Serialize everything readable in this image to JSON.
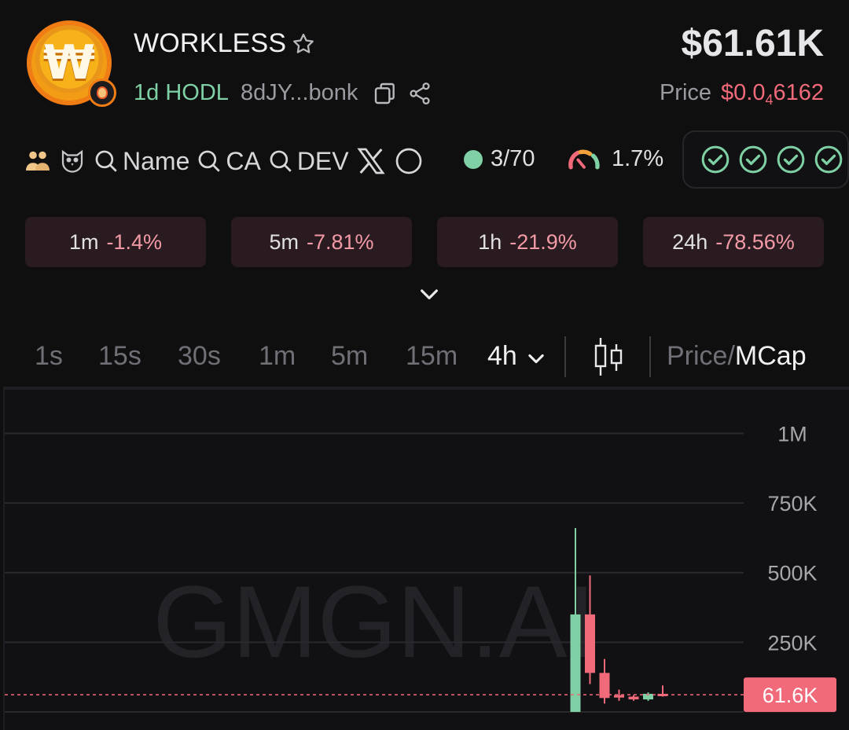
{
  "token": {
    "name": "WORKLESS",
    "logo_glyph": "₩",
    "age": "1d",
    "tag": "HODL",
    "contract_short": "8dJY...bonk",
    "market_cap": "$61.61K",
    "price_label": "Price",
    "price_prefix": "$0.0",
    "price_zeros": "4",
    "price_digits": "6162"
  },
  "toolbar": {
    "search_chips": [
      "Name",
      "CA",
      "DEV"
    ],
    "holders": "3/70",
    "top10_percent": "1.7%",
    "checks_count": 4
  },
  "changes": [
    {
      "period": "1m",
      "value": "-1.4%"
    },
    {
      "period": "5m",
      "value": "-7.81%"
    },
    {
      "period": "1h",
      "value": "-21.9%"
    },
    {
      "period": "24h",
      "value": "-78.56%"
    }
  ],
  "intervals": [
    "1s",
    "15s",
    "30s",
    "1m",
    "5m",
    "15m"
  ],
  "active_interval": "4h",
  "toggle": {
    "off": "Price/",
    "on": "MCap"
  },
  "colors": {
    "up": "#7fd0a5",
    "down": "#f06a7a",
    "accent": "#f06a7a"
  },
  "chart_data": {
    "type": "candlestick",
    "watermark": "GMGN.AI",
    "y_ticks": [
      "1M",
      "750K",
      "500K",
      "250K"
    ],
    "y_tick_values": [
      1000000,
      750000,
      500000,
      250000
    ],
    "ylim": [
      0,
      1100000
    ],
    "current_label": "61.6K",
    "current_value": 61600,
    "candles": [
      {
        "open": 0,
        "close": 350000,
        "high": 660000,
        "low": 0
      },
      {
        "open": 350000,
        "close": 140000,
        "high": 490000,
        "low": 100000
      },
      {
        "open": 140000,
        "close": 50000,
        "high": 190000,
        "low": 30000
      },
      {
        "open": 60000,
        "close": 55000,
        "high": 80000,
        "low": 40000
      },
      {
        "open": 55000,
        "close": 45000,
        "high": 60000,
        "low": 40000
      },
      {
        "open": 45000,
        "close": 65000,
        "high": 70000,
        "low": 40000
      },
      {
        "open": 65000,
        "close": 61600,
        "high": 95000,
        "low": 55000
      }
    ]
  }
}
